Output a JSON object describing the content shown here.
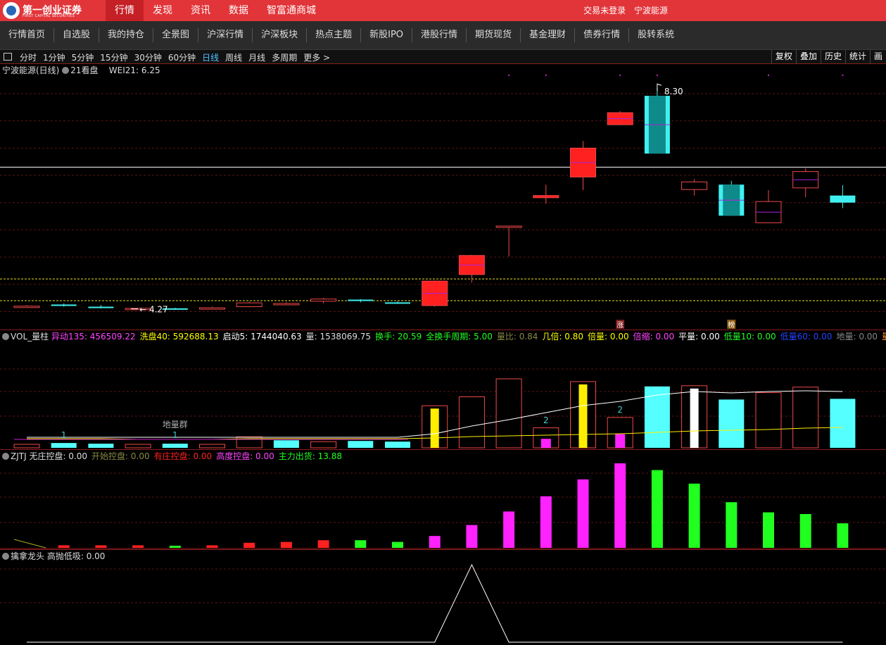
{
  "header": {
    "logo_cn": "第一创业证券",
    "logo_en": "FIRST CAPITAL SECURITIES",
    "menu": [
      "行情",
      "发现",
      "资讯",
      "数据",
      "智富通商城"
    ],
    "login_status": "交易未登录",
    "stock_name": "宁波能源"
  },
  "nav": [
    "行情首页",
    "自选股",
    "我的持仓",
    "全景图",
    "沪深行情",
    "沪深板块",
    "热点主题",
    "新股IPO",
    "港股行情",
    "期货现货",
    "基金理财",
    "债券行情",
    "股转系统"
  ],
  "toolbar": {
    "periods": [
      "分时",
      "1分钟",
      "5分钟",
      "15分钟",
      "30分钟",
      "60分钟",
      "日线",
      "周线",
      "月线",
      "多周期",
      "更多 >"
    ],
    "active_period": "日线",
    "buttons": [
      "复权",
      "叠加",
      "历史",
      "统计",
      "画"
    ]
  },
  "kline": {
    "title": "宁波能源(日线)",
    "tool": "21看盘",
    "indicator": "WEI21: 6.25",
    "high_label": "8.30",
    "low_label": "4.27",
    "tag_up": "涨",
    "tag_rank": "榜",
    "colors": {
      "up": "#ff2020",
      "up_outline": "#f04848",
      "down": "#40f0f0",
      "mid": "#aa22dd",
      "ma": "#ffffff",
      "guide": "#e8e020"
    },
    "candles": [
      {
        "o": 4.3,
        "c": 4.3,
        "h": 4.32,
        "l": 4.28,
        "up": true,
        "hollow": true
      },
      {
        "o": 4.33,
        "c": 4.31,
        "h": 4.35,
        "l": 4.29,
        "up": false
      },
      {
        "o": 4.29,
        "c": 4.27,
        "h": 4.32,
        "l": 4.26,
        "up": false
      },
      {
        "o": 4.25,
        "c": 4.26,
        "h": 4.27,
        "l": 4.25,
        "up": true,
        "hollow": true
      },
      {
        "o": 4.26,
        "c": 4.24,
        "h": 4.27,
        "l": 4.23,
        "up": false
      },
      {
        "o": 4.26,
        "c": 4.27,
        "h": 4.29,
        "l": 4.25,
        "up": true,
        "hollow": true
      },
      {
        "o": 4.29,
        "c": 4.36,
        "h": 4.38,
        "l": 4.28,
        "up": true,
        "hollow": true
      },
      {
        "o": 4.35,
        "c": 4.35,
        "h": 4.37,
        "l": 4.32,
        "up": true,
        "hollow": true
      },
      {
        "o": 4.39,
        "c": 4.43,
        "h": 4.45,
        "l": 4.35,
        "up": true,
        "hollow": true
      },
      {
        "o": 4.42,
        "c": 4.4,
        "h": 4.43,
        "l": 4.37,
        "up": false
      },
      {
        "o": 4.37,
        "c": 4.35,
        "h": 4.39,
        "l": 4.34,
        "up": false
      },
      {
        "o": 4.31,
        "c": 4.76,
        "h": 4.77,
        "l": 4.29,
        "up": true
      },
      {
        "o": 4.88,
        "c": 5.23,
        "h": 5.24,
        "l": 4.73,
        "up": true
      },
      {
        "o": 5.77,
        "c": 5.76,
        "h": 5.77,
        "l": 5.21,
        "up": true,
        "hollow": true
      },
      {
        "o": 6.33,
        "c": 6.29,
        "h": 6.53,
        "l": 6.18,
        "up": true
      },
      {
        "o": 6.67,
        "c": 7.2,
        "h": 7.33,
        "l": 6.43,
        "up": true
      },
      {
        "o": 7.63,
        "c": 7.85,
        "h": 7.88,
        "l": 7.62,
        "up": true
      },
      {
        "o": 8.16,
        "c": 7.1,
        "h": 8.3,
        "l": 7.1,
        "up": false
      },
      {
        "o": 6.44,
        "c": 6.58,
        "h": 6.63,
        "l": 6.33,
        "up": true,
        "hollow": true
      },
      {
        "o": 6.53,
        "c": 5.96,
        "h": 6.6,
        "l": 5.96,
        "up": false
      },
      {
        "o": 5.83,
        "c": 6.22,
        "h": 6.43,
        "l": 5.83,
        "up": true,
        "hollow": true
      },
      {
        "o": 6.47,
        "c": 6.77,
        "h": 6.83,
        "l": 6.3,
        "up": true,
        "hollow": true
      },
      {
        "o": 6.33,
        "c": 6.2,
        "h": 6.52,
        "l": 6.1,
        "up": false
      }
    ],
    "white_line": 6.85,
    "guide_lines": [
      4.8,
      4.4
    ],
    "grid": [
      8.2,
      7.7,
      7.2,
      6.7,
      6.2,
      5.7,
      5.2,
      4.7,
      4.2
    ]
  },
  "vol": {
    "title": "VOL_量柱",
    "items": [
      {
        "text": "异动135: 456509.22",
        "color": "#ff44ff"
      },
      {
        "text": "洗盘40: 592688.13",
        "color": "#ffff00"
      },
      {
        "text": "启动5: 1744040.63",
        "color": "#ffffff"
      },
      {
        "text": "量: 1538069.75",
        "color": "#dddddd"
      },
      {
        "text": "换手: 20.59",
        "color": "#20ff20"
      },
      {
        "text": "全换手周期: 5.00",
        "color": "#20ff20"
      },
      {
        "text": "量比: 0.84",
        "color": "#888844"
      },
      {
        "text": "几倍: 0.80",
        "color": "#ffff00"
      },
      {
        "text": "倍量: 0.00",
        "color": "#ffff00"
      },
      {
        "text": "倍缩: 0.00",
        "color": "#ff44ff"
      },
      {
        "text": "平量: 0.00",
        "color": "#ffffff"
      },
      {
        "text": "低量10: 0.00",
        "color": "#20ff20"
      },
      {
        "text": "低量60: 0.00",
        "color": "#2244ff"
      },
      {
        "text": "地量: 0.00",
        "color": "#888888"
      },
      {
        "text": "量能饱和",
        "color": "#ff9922"
      }
    ],
    "label_group": "地量群",
    "marks": [
      {
        "i": 1,
        "text": "1"
      },
      {
        "i": 4,
        "text": "1"
      },
      {
        "i": 14,
        "text": "2"
      },
      {
        "i": 16,
        "text": "2"
      }
    ],
    "bars": [
      {
        "v": 0.05,
        "t": "r"
      },
      {
        "v": 0.07,
        "t": "c"
      },
      {
        "v": 0.06,
        "t": "c"
      },
      {
        "v": 0.04,
        "t": "r"
      },
      {
        "v": 0.06,
        "t": "c"
      },
      {
        "v": 0.04,
        "t": "r"
      },
      {
        "v": 0.16,
        "t": "r"
      },
      {
        "v": 0.11,
        "t": "c"
      },
      {
        "v": 0.09,
        "t": "r"
      },
      {
        "v": 0.1,
        "t": "c"
      },
      {
        "v": 0.09,
        "t": "c"
      },
      {
        "v": 0.61,
        "t": "ry"
      },
      {
        "v": 0.74,
        "t": "r"
      },
      {
        "v": 1.0,
        "t": "r"
      },
      {
        "v": 0.29,
        "t": "rm"
      },
      {
        "v": 0.96,
        "t": "ry"
      },
      {
        "v": 0.44,
        "t": "rm"
      },
      {
        "v": 0.89,
        "t": "c"
      },
      {
        "v": 0.9,
        "t": "rw"
      },
      {
        "v": 0.7,
        "t": "c"
      },
      {
        "v": 0.8,
        "t": "r"
      },
      {
        "v": 0.88,
        "t": "r"
      },
      {
        "v": 0.71,
        "t": "c"
      }
    ],
    "ma_line": [
      0.15,
      0.15,
      0.15,
      0.15,
      0.15,
      0.15,
      0.15,
      0.15,
      0.15,
      0.15,
      0.15,
      0.2,
      0.31,
      0.4,
      0.5,
      0.6,
      0.66,
      0.75,
      0.8,
      0.78,
      0.8,
      0.81,
      0.8
    ],
    "ma2_line": [
      0.13,
      0.13,
      0.13,
      0.12,
      0.12,
      0.12,
      0.13,
      0.13,
      0.13,
      0.13,
      0.13,
      0.14,
      0.16,
      0.17,
      0.18,
      0.19,
      0.2,
      0.22,
      0.24,
      0.25,
      0.26,
      0.28,
      0.29
    ]
  },
  "zjtj": {
    "title": "ZJTJ",
    "items": [
      {
        "text": "无庄控盘: 0.00",
        "color": "#dddddd"
      },
      {
        "text": "开始控盘: 0.00",
        "color": "#888844"
      },
      {
        "text": "有庄控盘: 0.00",
        "color": "#ff2020"
      },
      {
        "text": "高度控盘: 0.00",
        "color": "#ff44ff"
      },
      {
        "text": "主力出货: 13.88",
        "color": "#20ff20"
      }
    ],
    "bars": [
      {
        "v": 0.0,
        "c": "r"
      },
      {
        "v": 0.03,
        "c": "r"
      },
      {
        "v": 0.03,
        "c": "r"
      },
      {
        "v": 0.03,
        "c": "r"
      },
      {
        "v": 0.02,
        "c": "g"
      },
      {
        "v": 0.03,
        "c": "r"
      },
      {
        "v": 0.06,
        "c": "r"
      },
      {
        "v": 0.07,
        "c": "r"
      },
      {
        "v": 0.09,
        "c": "r"
      },
      {
        "v": 0.09,
        "c": "g"
      },
      {
        "v": 0.07,
        "c": "g"
      },
      {
        "v": 0.14,
        "c": "m"
      },
      {
        "v": 0.27,
        "c": "m"
      },
      {
        "v": 0.43,
        "c": "m"
      },
      {
        "v": 0.61,
        "c": "m"
      },
      {
        "v": 0.81,
        "c": "m"
      },
      {
        "v": 1.0,
        "c": "m"
      },
      {
        "v": 0.92,
        "c": "g"
      },
      {
        "v": 0.76,
        "c": "g"
      },
      {
        "v": 0.54,
        "c": "g"
      },
      {
        "v": 0.42,
        "c": "g"
      },
      {
        "v": 0.4,
        "c": "g"
      },
      {
        "v": 0.29,
        "c": "g"
      }
    ]
  },
  "osc": {
    "title": "擒拿龙头",
    "item": "高抛低吸: 0.00",
    "line": [
      0,
      0,
      0,
      0,
      0,
      0,
      0,
      0,
      0,
      0,
      0,
      0,
      1.0,
      0,
      0,
      0,
      0,
      0,
      0,
      0,
      0,
      0,
      0
    ]
  }
}
